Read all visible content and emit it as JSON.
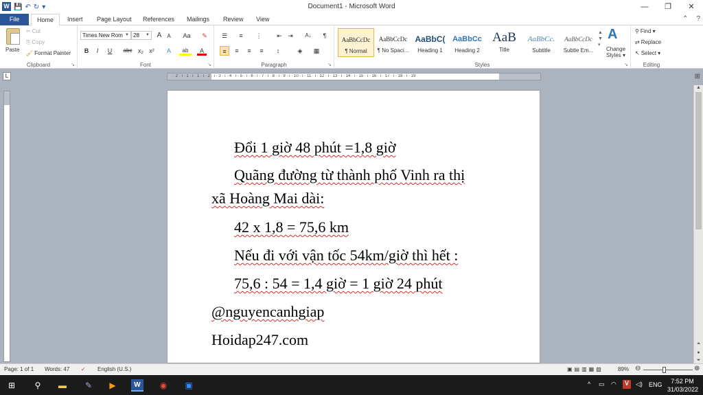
{
  "window": {
    "title": "Document1 - Microsoft Word",
    "app_icon": "W",
    "min_glyph": "—",
    "restore_glyph": "❐",
    "close_glyph": "✕"
  },
  "qat": {
    "save": "💾",
    "undo": "↶",
    "redo": "↻",
    "more": "▾"
  },
  "tabs": {
    "file": "File",
    "items": [
      "Home",
      "Insert",
      "Page Layout",
      "References",
      "Mailings",
      "Review",
      "View"
    ],
    "help_glyph": "?"
  },
  "clipboard": {
    "paste": "Paste",
    "cut": "Cut",
    "copy": "Copy",
    "format_painter": "Format Painter",
    "label": "Clipboard"
  },
  "font": {
    "name": "Times New Rom",
    "size": "28",
    "grow": "A",
    "shrink": "A",
    "case": "Aa",
    "clear": "✎",
    "bold": "B",
    "italic": "I",
    "underline": "U",
    "strike": "abc",
    "sub": "x₂",
    "sup": "x²",
    "effects": "A",
    "highlight": "ab",
    "color": "A",
    "label": "Font"
  },
  "paragraph": {
    "label": "Paragraph",
    "pilcrow": "¶",
    "sort": "A↓"
  },
  "styles": {
    "items": [
      {
        "sample": "AaBbCcDc",
        "name": "¶ Normal"
      },
      {
        "sample": "AaBbCcDc",
        "name": "¶ No Spaci..."
      },
      {
        "sample": "AaBbC(",
        "name": "Heading 1"
      },
      {
        "sample": "AaBbCc",
        "name": "Heading 2"
      },
      {
        "sample": "AaB",
        "name": "Title"
      },
      {
        "sample": "AaBbCc.",
        "name": "Subtitle"
      },
      {
        "sample": "AaBbCcDc",
        "name": "Subtle Em..."
      }
    ],
    "change_line1": "Change",
    "change_line2": "Styles ▾",
    "label": "Styles"
  },
  "editing": {
    "find": "Find ▾",
    "replace": "Replace",
    "select": "Select ▾",
    "label": "Editing"
  },
  "ruler": {
    "numbers": "· 2 · ı · 1 · ı · 1 · ı · 2 · ı · 3 · ı · 4 · ı · 5 · ı · 6 · ı · 7 · ı · 8 · ı · 9 · ı · 10 · ı · 11 · ı · 12 · ı · 13 · ı · 14 · ı · 15 · ı · 16 · ı · 17 · ı · 18 · ı · 19"
  },
  "document": {
    "line1": "Đổi 1 giờ 48 phút =1,8 giờ",
    "line2a": "Quãng đường từ thành phố Vinh ra thị",
    "line2b": "xã Hoàng Mai dài:",
    "line3": "42 x 1,8 = 75,6 km",
    "line4": "Nếu đi với vận tốc 54km/giờ thì hết :",
    "line5": "75,6 : 54 = 1,4 giờ =  1 giờ 24 phút",
    "line6": "@nguyencanhgiap",
    "line7": "Hoidap247.com"
  },
  "status": {
    "page": "Page: 1 of 1",
    "words": "Words: 47",
    "language": "English (U.S.)",
    "zoom": "89%"
  },
  "taskbar": {
    "lang": "ENG",
    "time": "7:52 PM",
    "date": "31/03/2022"
  }
}
